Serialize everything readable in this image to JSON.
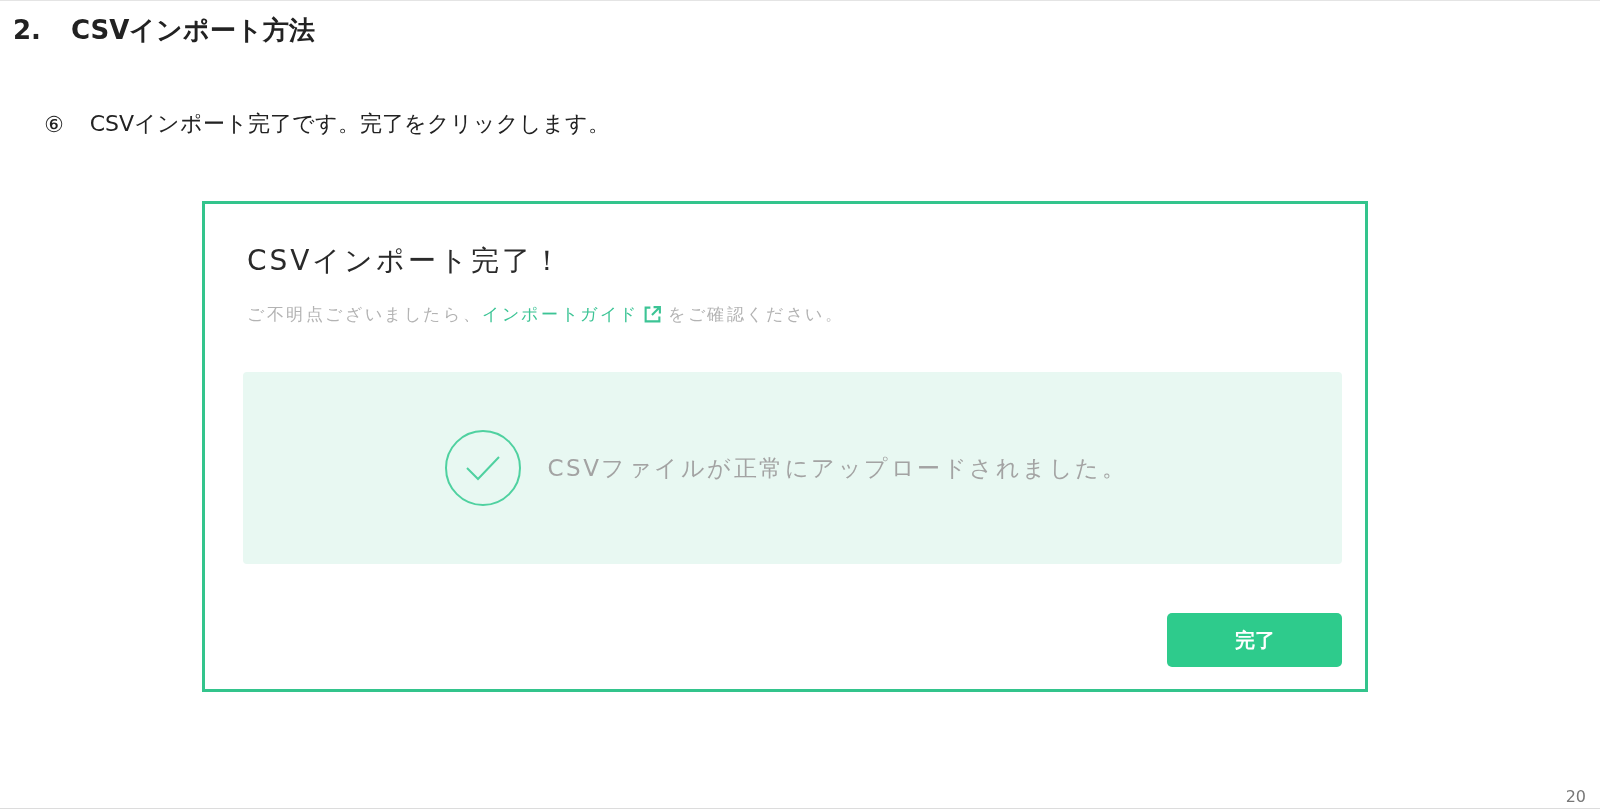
{
  "heading": {
    "number": "2.",
    "title": "CSVインポート方法"
  },
  "step": {
    "marker": "⑥",
    "text": "CSVインポート完了です。完了をクリックします。"
  },
  "screenshot": {
    "title": "CSVインポート完了！",
    "help": {
      "before": "ご不明点ございましたら、",
      "link": "インポートガイド",
      "after": "をご確認ください。"
    },
    "message": "CSVファイルが正常にアップロードされました。",
    "button": "完了"
  },
  "page_number": "20"
}
